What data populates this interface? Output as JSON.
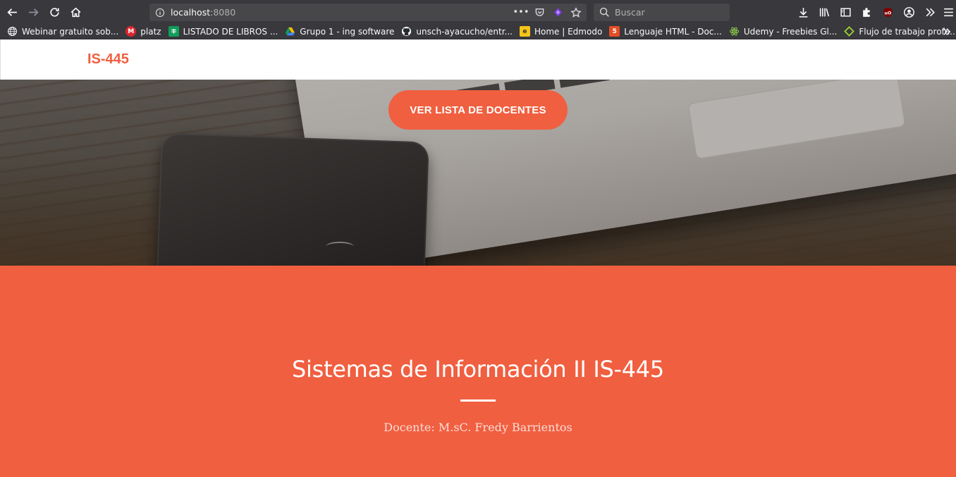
{
  "browser": {
    "url_host": "localhost",
    "url_port": ":8080",
    "search_placeholder": "Buscar",
    "more_dots": "•••",
    "bookmarks": [
      {
        "label": "Webinar gratuito sob...",
        "icon": "globe-icon",
        "color": "#f9f9fa"
      },
      {
        "label": "platz",
        "icon": "mega-icon",
        "color": "#d9272e"
      },
      {
        "label": "LISTADO DE LIBROS ...",
        "icon": "sheets-icon",
        "color": "#0f9d58"
      },
      {
        "label": "Grupo 1 - ing software",
        "icon": "drive-icon",
        "color": "#fbbc04"
      },
      {
        "label": "unsch-ayacucho/entr...",
        "icon": "github-icon",
        "color": "#24292e"
      },
      {
        "label": "Home | Edmodo",
        "icon": "edmodo-icon",
        "color": "#f5c518"
      },
      {
        "label": "Lenguaje HTML - Doc...",
        "icon": "html5-icon",
        "color": "#e44d26"
      },
      {
        "label": "Udemy - Freebies Gl...",
        "icon": "atom-icon",
        "color": "#8bc34a"
      },
      {
        "label": "Flujo de trabajo profe...",
        "icon": "diamond-icon",
        "color": "#9acd32"
      }
    ]
  },
  "page": {
    "brand": "IS-445",
    "cta_label": "VER LISTA DE DOCENTES",
    "heading": "Sistemas de Información II IS-445",
    "subtitle": "Docente: M.sC. Fredy Barrientos",
    "accent_color": "#f05f40"
  }
}
